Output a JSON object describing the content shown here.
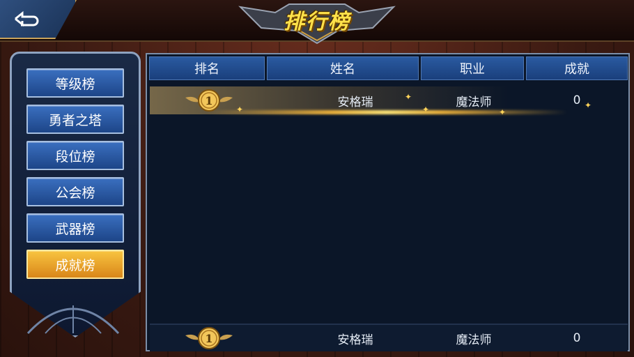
{
  "title": "排行榜",
  "nav": [
    {
      "label": "等级榜",
      "active": false
    },
    {
      "label": "勇者之塔",
      "active": false
    },
    {
      "label": "段位榜",
      "active": false
    },
    {
      "label": "公会榜",
      "active": false
    },
    {
      "label": "武器榜",
      "active": false
    },
    {
      "label": "成就榜",
      "active": true
    }
  ],
  "table": {
    "headers": {
      "rank": "排名",
      "name": "姓名",
      "job": "职业",
      "achievement": "成就"
    },
    "rows": [
      {
        "rank": "1",
        "name": "安格瑞",
        "job": "魔法师",
        "achievement": "0"
      }
    ]
  },
  "my_rank": {
    "rank": "1",
    "name": "安格瑞",
    "job": "魔法师",
    "achievement": "0"
  },
  "colors": {
    "accent_gold": "#f8c440",
    "nav_blue": "#2a5aa0",
    "title_yellow": "#ffe14a"
  }
}
